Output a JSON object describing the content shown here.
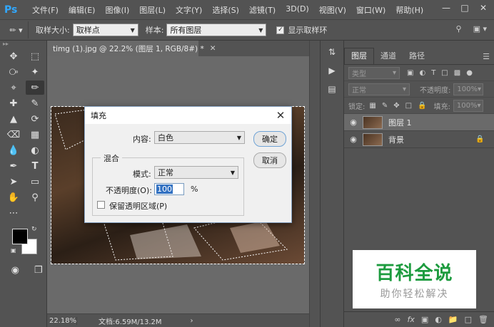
{
  "app": {
    "logo": "Ps"
  },
  "menu": [
    "文件(F)",
    "编辑(E)",
    "图像(I)",
    "图层(L)",
    "文字(Y)",
    "选择(S)",
    "滤镜(T)",
    "3D(D)",
    "视图(V)",
    "窗口(W)",
    "帮助(H)"
  ],
  "options": {
    "sample_size_label": "取样大小:",
    "sample_size_value": "取样点",
    "sample_label": "样本:",
    "sample_value": "所有图层",
    "show_ring_label": "显示取样环",
    "show_ring_checked": true
  },
  "document": {
    "tab_title": "timg (1).jpg @ 22.2% (图层 1, RGB/8#) *",
    "zoom": "22.18%",
    "doc_info": "文档:6.59M/13.2M"
  },
  "layers_panel": {
    "tabs": [
      "图层",
      "通道",
      "路径"
    ],
    "active_tab": "图层",
    "kind_filter": "类型",
    "blend_mode": "正常",
    "opacity_label": "不透明度:",
    "opacity_value": "100%",
    "lock_label": "锁定:",
    "fill_label": "填充:",
    "fill_value": "100%",
    "layers": [
      {
        "name": "图层 1",
        "selected": true,
        "locked": false
      },
      {
        "name": "背景",
        "selected": false,
        "locked": true
      }
    ]
  },
  "dialog": {
    "title": "填充",
    "contents_label": "内容:",
    "contents_value": "白色",
    "ok_label": "确定",
    "cancel_label": "取消",
    "blending_group": "混合",
    "mode_label": "模式:",
    "mode_value": "正常",
    "opacity_label": "不透明度(O):",
    "opacity_value": "100",
    "opacity_unit": "%",
    "preserve_label": "保留透明区域(P)",
    "preserve_checked": false
  },
  "watermark": {
    "line1": "百科全说",
    "line2": "助你轻松解决",
    "color": "#1c9b3e"
  },
  "icons": {
    "minimize": "minimize-icon",
    "restore": "restore-icon",
    "close": "close-icon"
  }
}
